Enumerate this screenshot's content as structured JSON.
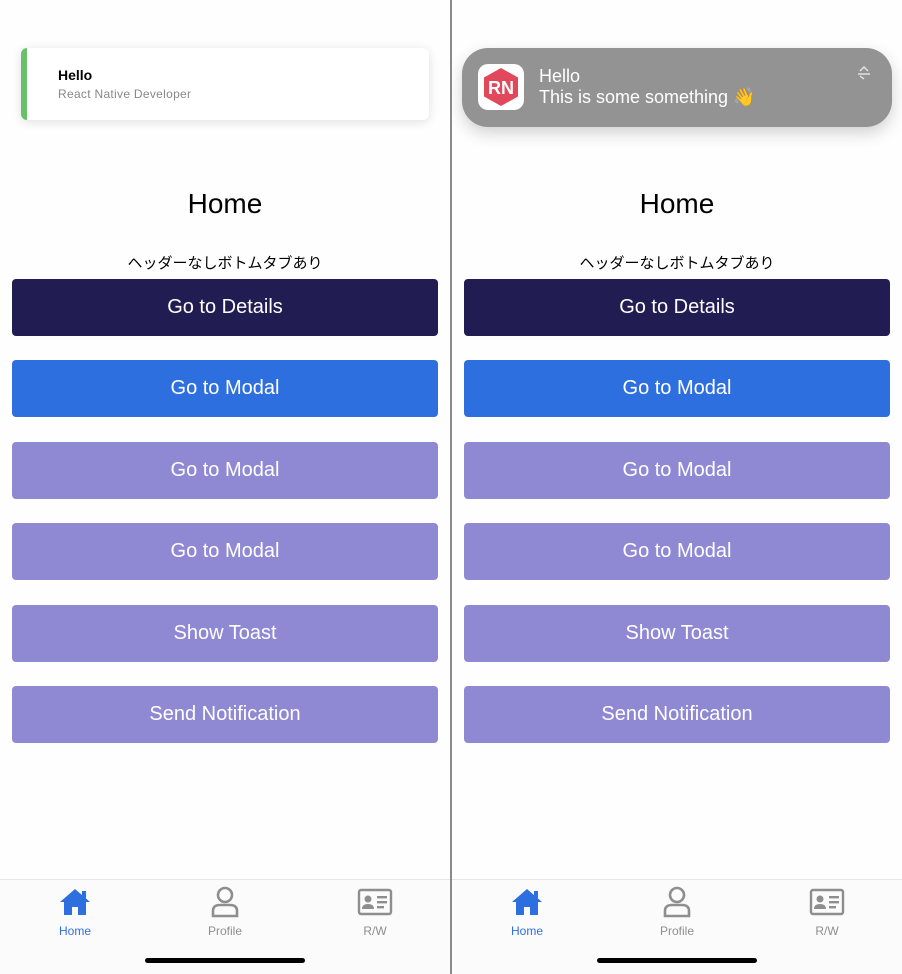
{
  "left": {
    "toast": {
      "title": "Hello",
      "subtitle": "React Native Developer",
      "accent_color": "#69c06a"
    }
  },
  "right": {
    "notification": {
      "app_icon": "react-native-app-icon",
      "app_icon_text": "RN",
      "title": "Hello",
      "body": "This is some something 👋",
      "expand_icon": "expand-icon"
    }
  },
  "home": {
    "title": "Home",
    "subtitle": "ヘッダーなしボトムタブあり"
  },
  "buttons": [
    {
      "label": "Go to Details",
      "color": "#211d52"
    },
    {
      "label": "Go to Modal",
      "color": "#2e6fe0"
    },
    {
      "label": "Go to Modal",
      "color": "#8f89d4"
    },
    {
      "label": "Go to Modal",
      "color": "#8f89d4"
    },
    {
      "label": "Show Toast",
      "color": "#8f89d4"
    },
    {
      "label": "Send Notification",
      "color": "#8f89d4"
    }
  ],
  "tabs": [
    {
      "label": "Home",
      "icon": "home-icon",
      "active": true
    },
    {
      "label": "Profile",
      "icon": "profile-icon",
      "active": false
    },
    {
      "label": "R/W",
      "icon": "id-card-icon",
      "active": false
    }
  ],
  "colors": {
    "active_tab": "#2e6fe0",
    "inactive_tab": "#8e8e8e"
  }
}
